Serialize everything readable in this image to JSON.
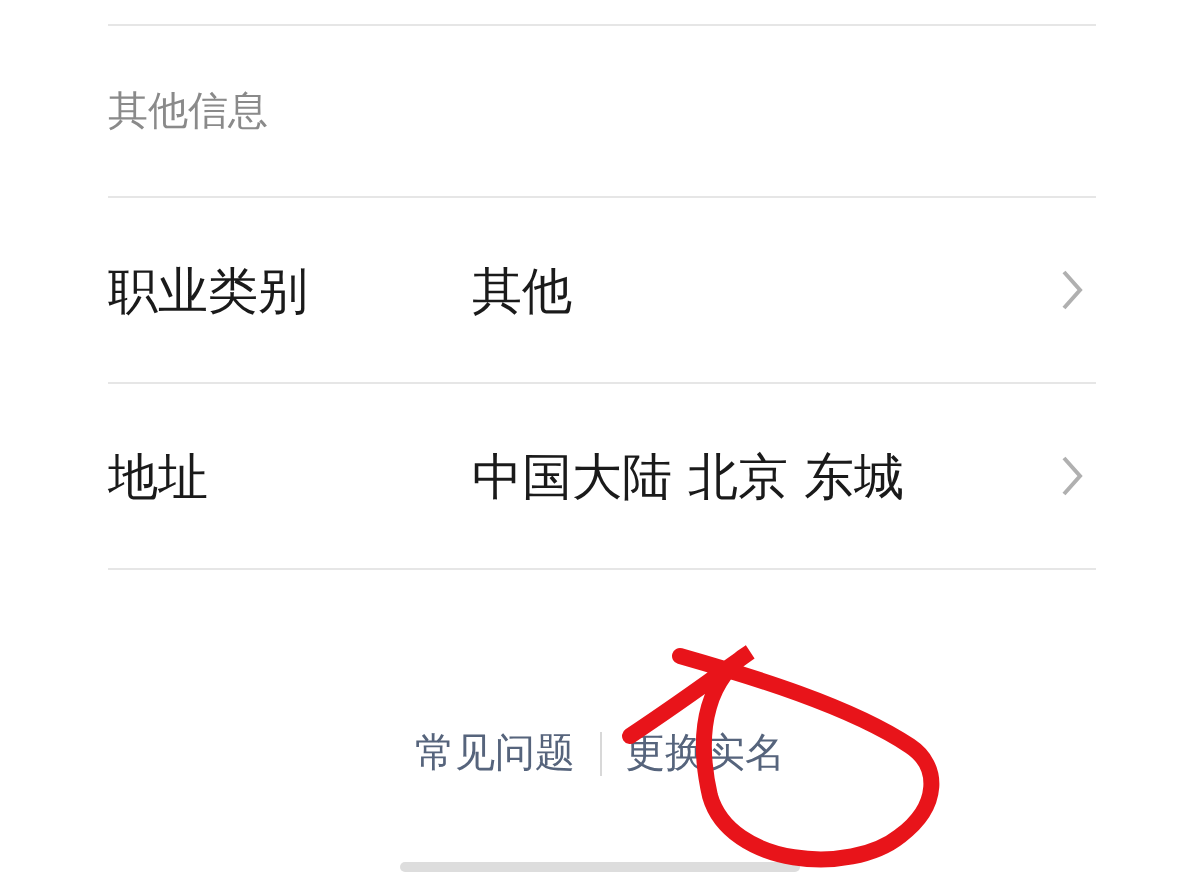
{
  "section": {
    "title": "其他信息"
  },
  "rows": [
    {
      "label": "职业类别",
      "value": "其他"
    },
    {
      "label": "地址",
      "value": "中国大陆 北京 东城"
    }
  ],
  "footer_links": [
    "常见问题",
    "更换实名"
  ]
}
